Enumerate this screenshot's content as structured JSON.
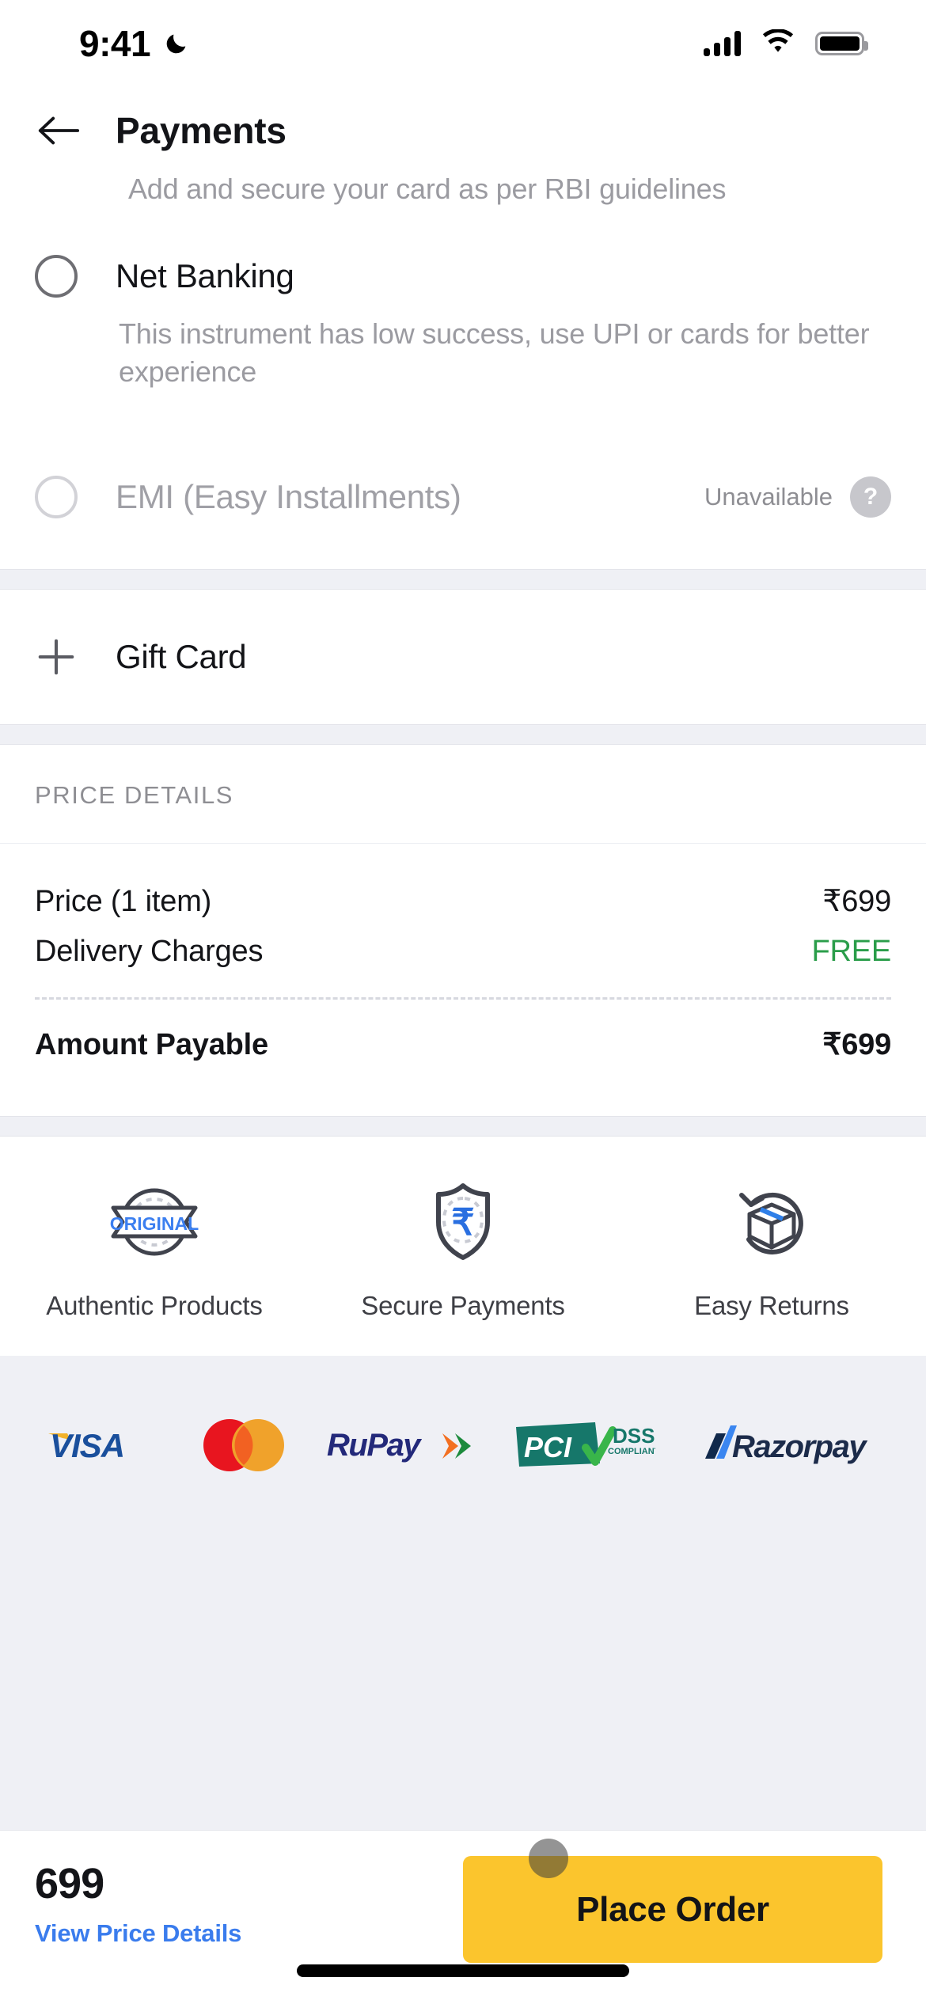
{
  "status_bar": {
    "time": "9:41",
    "moon_icon": "crescent-moon-icon",
    "signal_icon": "cellular-signal-icon",
    "wifi_icon": "wifi-icon",
    "battery_icon": "battery-full-icon"
  },
  "header": {
    "back_icon": "back-arrow-icon",
    "title": "Payments",
    "subtitle": "Add and secure your card as per RBI guidelines"
  },
  "payment_options": [
    {
      "id": "net-banking",
      "label": "Net Banking",
      "description": "This instrument has low success, use UPI or cards for better experience",
      "selected": false,
      "disabled": false,
      "status": "",
      "help_icon": ""
    },
    {
      "id": "emi",
      "label": "EMI (Easy Installments)",
      "description": "",
      "selected": false,
      "disabled": true,
      "status": "Unavailable",
      "help_icon": "help-question-icon"
    }
  ],
  "gift_card": {
    "plus_icon": "plus-icon",
    "label": "Gift Card"
  },
  "price_details": {
    "heading": "PRICE DETAILS",
    "rows": [
      {
        "label": "Price (1 item)",
        "value": "₹699",
        "free": false
      },
      {
        "label": "Delivery Charges",
        "value": "FREE",
        "free": true
      }
    ],
    "total": {
      "label": "Amount Payable",
      "value": "₹699"
    }
  },
  "trust_badges": [
    {
      "icon": "original-seal-icon",
      "label": "Authentic Products"
    },
    {
      "icon": "shield-rupee-icon",
      "label": "Secure Payments"
    },
    {
      "icon": "returns-box-icon",
      "label": "Easy Returns"
    }
  ],
  "partners": [
    {
      "icon": "visa-logo",
      "name": "VISA"
    },
    {
      "icon": "mastercard-logo",
      "name": "Mastercard"
    },
    {
      "icon": "rupay-logo",
      "name": "RuPay"
    },
    {
      "icon": "pci-dss-logo",
      "name": "PCI DSS COMPLIANT"
    },
    {
      "icon": "razorpay-logo",
      "name": "Razorpay"
    }
  ],
  "pci_logo": {
    "main": "PCI",
    "sub1": "DSS",
    "sub2": "COMPLIANT"
  },
  "bottom_bar": {
    "amount": "699",
    "price_link": "View Price Details",
    "place_order_label": "Place Order",
    "touch_indicator": "touch-point-indicator"
  },
  "colors": {
    "accent_yellow": "#fbc52d",
    "link_blue": "#3a7ced",
    "free_green": "#2a9d4a",
    "panel_grey": "#eff0f5"
  }
}
